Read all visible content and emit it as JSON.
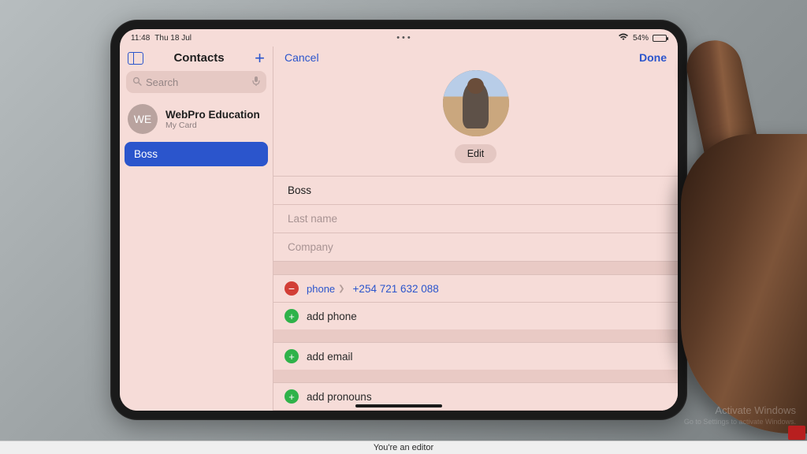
{
  "statusbar": {
    "time": "11:48",
    "date": "Thu 18 Jul",
    "battery_pct": "54%"
  },
  "sidebar": {
    "title": "Contacts",
    "search_placeholder": "Search",
    "mycard": {
      "initials": "WE",
      "name": "WebPro Education",
      "sub": "My Card"
    },
    "selected_contact": "Boss"
  },
  "detail": {
    "cancel": "Cancel",
    "done": "Done",
    "edit": "Edit",
    "first_name_value": "Boss",
    "last_name_placeholder": "Last name",
    "company_placeholder": "Company",
    "phone": {
      "kind": "phone",
      "value": "+254 721 632 088"
    },
    "add_phone": "add phone",
    "add_email": "add email",
    "add_pronouns": "add pronouns"
  },
  "watermark": {
    "title": "Activate Windows",
    "sub": "Go to Settings to activate Windows."
  },
  "bottombar": "You're an editor"
}
